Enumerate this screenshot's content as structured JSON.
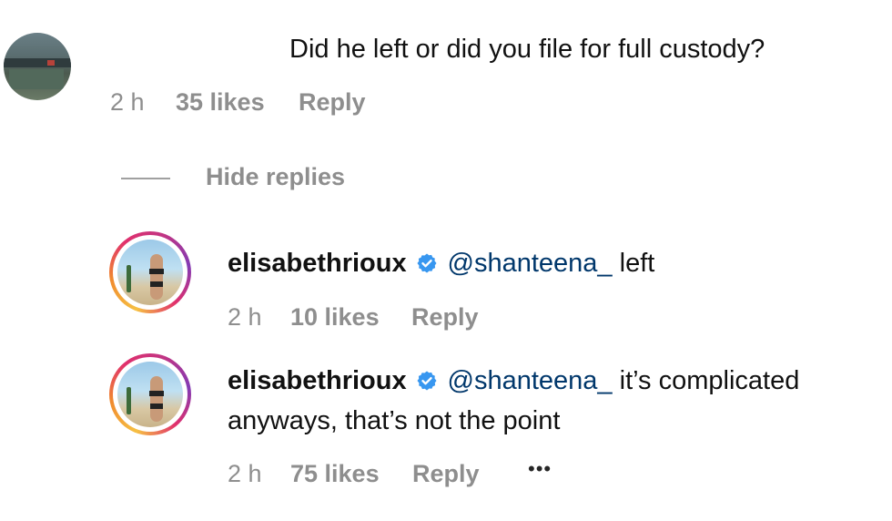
{
  "comment": {
    "text": "Did he left or did you file for full custody?",
    "time": "2 h",
    "likes": "35 likes",
    "reply_label": "Reply"
  },
  "replies_toggle": "Hide replies",
  "replies": [
    {
      "username": "elisabethrioux",
      "mention": "@shanteena_",
      "text": " left",
      "time": "2 h",
      "likes": "10 likes",
      "reply_label": "Reply"
    },
    {
      "username": "elisabethrioux",
      "mention": "@shanteena_",
      "text": " it’s complicated",
      "text_line2": "anyways, that’s not the point",
      "time": "2 h",
      "likes": "75 likes",
      "reply_label": "Reply",
      "more": "•••"
    }
  ],
  "colors": {
    "verified": "#3897f0",
    "meta": "#8e8e8e",
    "mention": "#00376b"
  },
  "icons": {
    "verified": "verified-badge-icon",
    "more": "more-options-icon"
  }
}
